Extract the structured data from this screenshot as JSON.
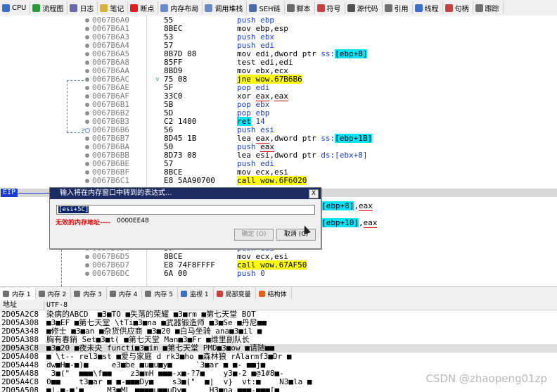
{
  "toolbar": [
    {
      "label": "CPU",
      "icon": "cpu-icon",
      "color": "#3a6fc8"
    },
    {
      "label": "流程图",
      "icon": "graph-icon",
      "color": "#2a9a3a"
    },
    {
      "label": "日志",
      "icon": "log-icon",
      "color": "#6a6aa8"
    },
    {
      "label": "笔记",
      "icon": "notes-icon",
      "color": "#d8b040"
    },
    {
      "label": "断点",
      "icon": "breakpoint-icon",
      "color": "#e02020"
    },
    {
      "label": "内存布局",
      "icon": "memory-map-icon",
      "color": "#6a8ac8"
    },
    {
      "label": "调用堆栈",
      "icon": "call-stack-icon",
      "color": "#6a8ac8"
    },
    {
      "label": "SEH链",
      "icon": "seh-icon",
      "color": "#4a6aa8"
    },
    {
      "label": "脚本",
      "icon": "script-icon",
      "color": "#6a6a6a"
    },
    {
      "label": "符号",
      "icon": "symbol-icon",
      "color": "#c84040"
    },
    {
      "label": "源代码",
      "icon": "source-icon",
      "color": "#505050"
    },
    {
      "label": "引用",
      "icon": "references-icon",
      "color": "#707070"
    },
    {
      "label": "线程",
      "icon": "threads-icon",
      "color": "#3a6fc8"
    },
    {
      "label": "句柄",
      "icon": "handles-icon",
      "color": "#c84040"
    },
    {
      "label": "跟踪",
      "icon": "trace-icon",
      "color": "#707070"
    }
  ],
  "disasm": [
    {
      "addr": "0067B6A0",
      "bytes": "55",
      "instr": [
        {
          "t": "push ebp",
          "c": "mn"
        }
      ],
      "dot": "filled"
    },
    {
      "addr": "0067B6A1",
      "bytes": "8BEC",
      "instr": [
        {
          "t": "mov ebp,esp"
        }
      ],
      "dot": "filled"
    },
    {
      "addr": "0067B6A3",
      "bytes": "53",
      "instr": [
        {
          "t": "push ebx",
          "c": "mn"
        }
      ],
      "dot": "filled"
    },
    {
      "addr": "0067B6A4",
      "bytes": "57",
      "instr": [
        {
          "t": "push edi",
          "c": "mn"
        }
      ],
      "dot": "filled"
    },
    {
      "addr": "0067B6A5",
      "bytes": "8B7D 08",
      "instr": [
        {
          "t": "mov edi,dword ptr "
        },
        {
          "t": "ss:",
          "c": "mem"
        },
        {
          "t": "[ebp+8]",
          "c": "cyan"
        }
      ],
      "dot": "filled"
    },
    {
      "addr": "0067B6A8",
      "bytes": "85FF",
      "instr": [
        {
          "t": "test edi,edi"
        }
      ],
      "dot": "filled"
    },
    {
      "addr": "0067B6AA",
      "bytes": "8BD9",
      "instr": [
        {
          "t": "mov ebx,ecx"
        }
      ],
      "dot": "filled"
    },
    {
      "addr": "0067B6AC",
      "bytes": "75 08",
      "instr": [
        {
          "t": "jne wow.67B6B6",
          "c": "yellow"
        }
      ],
      "dot": "filled",
      "mark": "v"
    },
    {
      "addr": "0067B6AE",
      "bytes": "5F",
      "instr": [
        {
          "t": "pop edi",
          "c": "mn"
        }
      ],
      "dot": "filled"
    },
    {
      "addr": "0067B6AF",
      "bytes": "33C0",
      "instr": [
        {
          "t": "xor "
        },
        {
          "t": "eax",
          "c": "ul"
        },
        {
          "t": ","
        },
        {
          "t": "eax",
          "c": "ul"
        }
      ],
      "dot": "filled"
    },
    {
      "addr": "0067B6B1",
      "bytes": "5B",
      "instr": [
        {
          "t": "pop ebx",
          "c": "mn"
        }
      ],
      "dot": "filled"
    },
    {
      "addr": "0067B6B2",
      "bytes": "5D",
      "instr": [
        {
          "t": "pop ebp",
          "c": "mn"
        }
      ],
      "dot": "filled"
    },
    {
      "addr": "0067B6B3",
      "bytes": "C2 1400",
      "instr": [
        {
          "t": "ret",
          "c": "cyan"
        },
        {
          "t": " 14",
          "c": "mn"
        }
      ],
      "dot": "filled"
    },
    {
      "addr": "0067B6B6",
      "bytes": "56",
      "instr": [
        {
          "t": "push esi",
          "c": "mn"
        }
      ],
      "dot": "open",
      "mark": ">"
    },
    {
      "addr": "0067B6B7",
      "bytes": "8D45 1B",
      "instr": [
        {
          "t": "lea "
        },
        {
          "t": "eax",
          "c": "ul"
        },
        {
          "t": ",dword ptr "
        },
        {
          "t": "ss:",
          "c": "mem"
        },
        {
          "t": "[ebp+1B]",
          "c": "cyan"
        }
      ],
      "dot": "filled"
    },
    {
      "addr": "0067B6BA",
      "bytes": "50",
      "instr": [
        {
          "t": "push ",
          "c": "mn"
        },
        {
          "t": "eax",
          "c": "ul"
        }
      ],
      "dot": "filled"
    },
    {
      "addr": "0067B6BB",
      "bytes": "8D73 08",
      "instr": [
        {
          "t": "lea esi,dword ptr "
        },
        {
          "t": "ds:[ebx+8]",
          "c": "mem"
        }
      ],
      "dot": "filled"
    },
    {
      "addr": "0067B6BE",
      "bytes": "57",
      "instr": [
        {
          "t": "push edi",
          "c": "mn"
        }
      ],
      "dot": "filled"
    },
    {
      "addr": "0067B6BF",
      "bytes": "8BCE",
      "instr": [
        {
          "t": "mov ecx,esi"
        }
      ],
      "dot": "filled"
    },
    {
      "addr": "0067B6C1",
      "bytes": "E8 5AA90700",
      "instr": [
        {
          "t": "call wow.6F6020",
          "c": "yellow"
        }
      ],
      "dot": "filled"
    },
    {
      "addr": "",
      "bytes": "",
      "instr": [],
      "dot": "none"
    },
    {
      "addr": "",
      "bytes": "",
      "instr": [],
      "dot": "none"
    },
    {
      "addr": "",
      "bytes": "",
      "instr": [
        {
          "t": "[ebp+8]",
          "c": "cyan"
        },
        {
          "t": ","
        },
        {
          "t": "eax",
          "c": "ul"
        }
      ],
      "dot": "none",
      "partial": true
    },
    {
      "addr": "",
      "bytes": "",
      "instr": [],
      "dot": "none"
    },
    {
      "addr": "",
      "bytes": "",
      "instr": [
        {
          "t": "[ebp+10]",
          "c": "cyan"
        },
        {
          "t": ","
        },
        {
          "t": "eax",
          "c": "ul"
        }
      ],
      "dot": "none",
      "partial": true
    },
    {
      "addr": "",
      "bytes": "",
      "instr": [],
      "dot": "none"
    },
    {
      "addr": "",
      "bytes": "",
      "instr": [],
      "dot": "none"
    },
    {
      "addr": "0067B6D4",
      "bytes": "57",
      "instr": [
        {
          "t": "push edi",
          "c": "mn"
        }
      ],
      "dot": "filled"
    },
    {
      "addr": "0067B6D5",
      "bytes": "8BCE",
      "instr": [
        {
          "t": "mov ecx,esi"
        }
      ],
      "dot": "filled"
    },
    {
      "addr": "0067B6D7",
      "bytes": "E8 74F8FFFF",
      "instr": [
        {
          "t": "call wow.67AF50",
          "c": "yellow"
        }
      ],
      "dot": "filled"
    },
    {
      "addr": "0067B6DC",
      "bytes": "6A 00",
      "instr": [
        {
          "t": "push 0",
          "c": "mn"
        }
      ],
      "dot": "filled"
    }
  ],
  "eip_label": "EIP",
  "dialog": {
    "title": "输入将在内存窗口中转到的表达式...",
    "close": "X",
    "input_value": "[esi+5C]",
    "error": "无效的内存地址----",
    "address": "0000EE48",
    "ok_label": "确定 (O)",
    "cancel_label": "取消 (C)"
  },
  "memtabs": [
    {
      "label": "内存 1",
      "icon": "memory-icon",
      "active": true
    },
    {
      "label": "内存 2",
      "icon": "memory-icon"
    },
    {
      "label": "内存 3",
      "icon": "memory-icon"
    },
    {
      "label": "内存 4",
      "icon": "memory-icon"
    },
    {
      "label": "内存 5",
      "icon": "memory-icon"
    },
    {
      "label": "监视 1",
      "icon": "watch-icon"
    },
    {
      "label": "局部变量",
      "icon": "locals-icon"
    },
    {
      "label": "结构体",
      "icon": "struct-icon"
    }
  ],
  "dump": {
    "col_addr": "地址",
    "col_text": "UTF-8",
    "rows": [
      {
        "a": "2D05A2C8",
        "t": "染病的ABCD  ■3■TO ■失落的荣耀 ■3■rm ■第七天堂 BOT"
      },
      {
        "a": "2D05A308",
        "t": "■3■EF ■第七天堂 \\tTi■3■na ■武器锻造师 ■3■Se ■丹尼■■"
      },
      {
        "a": "2D05A348",
        "t": "■修士 ■3■an ■杂货供应商 ■3■20 ■白马坐骑 ana■3■il ■"
      },
      {
        "a": "2D05A388",
        "t": "胸有春銷 Set■3■t( ■第七天堂 Man■3■Fr ■维里副队长"
      },
      {
        "a": "2D05A3C8",
        "t": "■3■20 ■夜未央 functi■3■im ■第七天堂 PMD■3■ow ■请随■■",
        "hl": true
      },
      {
        "a": "2D05A408",
        "t": "■ \\t-- rel3■st ■爱与家庭 d rk3■ho ■森林狼 rAlarmf3■Dr ■"
      },
      {
        "a": "2D05A448",
        "t": "dw■H■-■)■     e3■be ■u■u■y■     `3■ar ■ ■- ■■j■"
      },
      {
        "a": "2D05A488",
        "t": " 3■(\"  ■■■\\f■■    z3■mH ■■■-x■-?7■    y3■-2 ■@1#8■-"
      },
      {
        "a": "2D05A4C8",
        "t": "0■■    t3■ar ■ ■-■■■Dy■    s3■(\"  ■|  v}  vt:■    N3■la ■"
      },
      {
        "a": "2D05A508",
        "t": "■|.■-■'■     M3■ML ■■■■u■■uDv■     H3■na ■■■-■■■[■"
      }
    ]
  },
  "watermark": "CSDN @zhaopeng01zp"
}
